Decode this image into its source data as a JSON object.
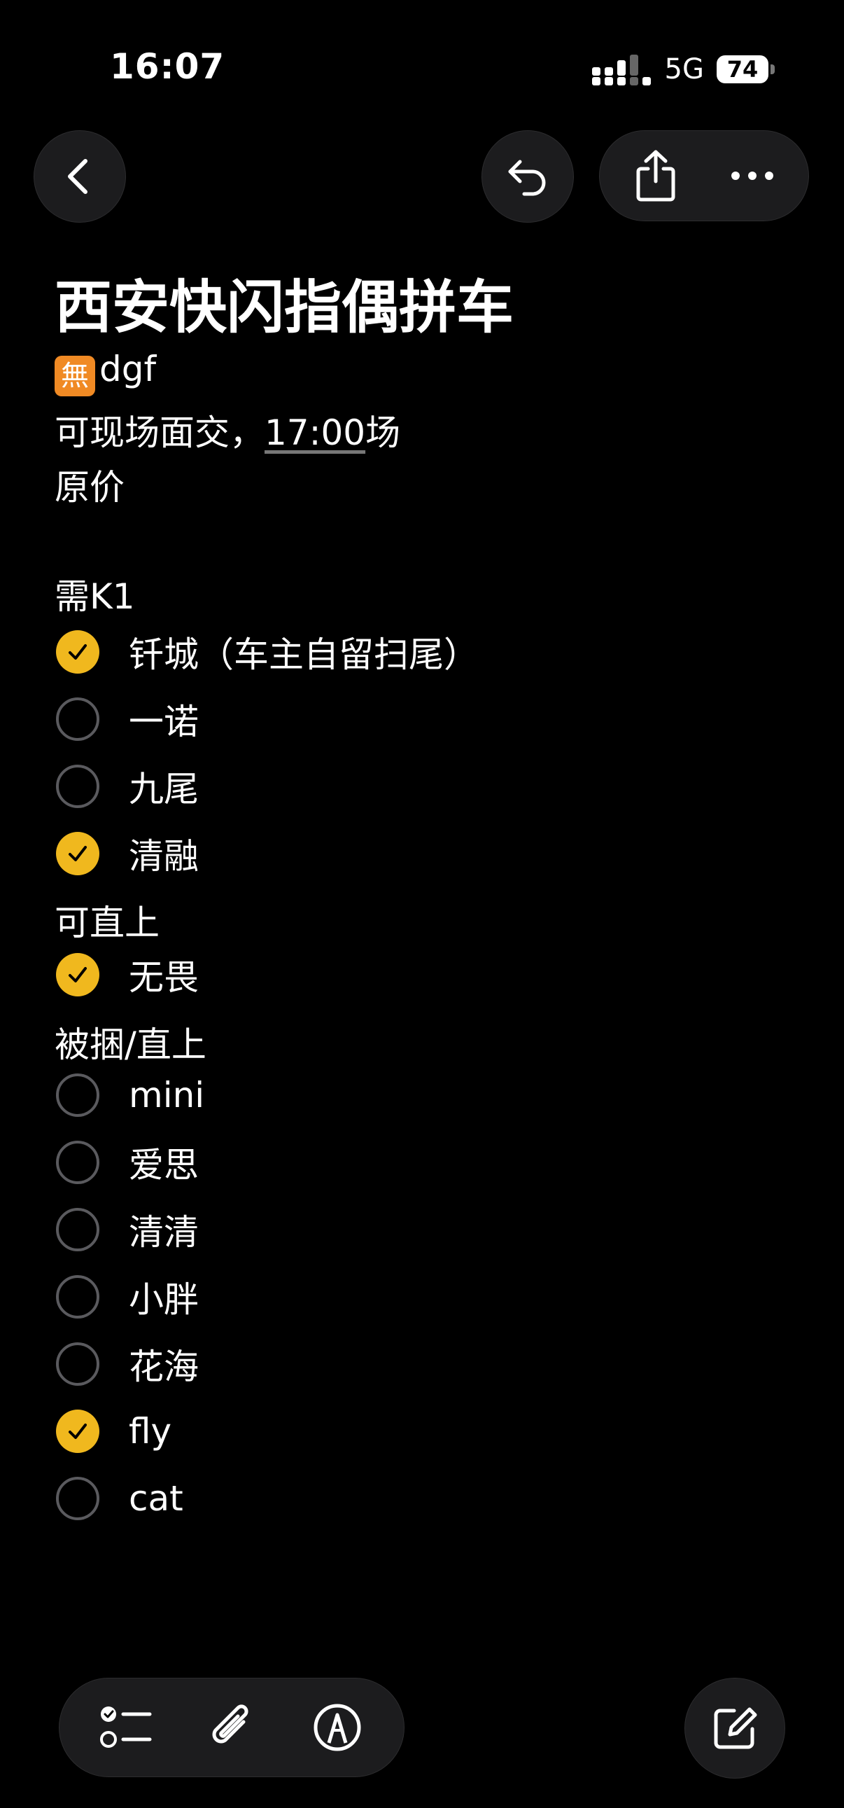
{
  "status_bar": {
    "time": "16:07",
    "network": "5G",
    "battery": "74"
  },
  "note": {
    "title": "西安快闪指偶拼车",
    "tag_glyph": "🈚",
    "tag_text": "dgf",
    "line2_prefix": "可现场面交，",
    "line2_time": "17:00",
    "line2_suffix": "场",
    "line3": "原价",
    "section1": "需K1",
    "section2": "可直上",
    "section3": "被捆/直上",
    "items1": [
      {
        "label": "钎城（车主自留扫尾）",
        "checked": true
      },
      {
        "label": "一诺",
        "checked": false
      },
      {
        "label": "九尾",
        "checked": false
      },
      {
        "label": "清融",
        "checked": true
      }
    ],
    "items2": [
      {
        "label": "无畏",
        "checked": true
      }
    ],
    "items3": [
      {
        "label": "mini",
        "checked": false
      },
      {
        "label": "爱思",
        "checked": false
      },
      {
        "label": "清清",
        "checked": false
      },
      {
        "label": "小胖",
        "checked": false
      },
      {
        "label": "花海",
        "checked": false
      },
      {
        "label": "fly",
        "checked": true
      },
      {
        "label": "cat",
        "checked": false
      }
    ]
  },
  "colors": {
    "accent": "#f0b81e",
    "background": "#000000",
    "button": "#1c1c1e"
  },
  "icons": [
    "chevron-left-icon",
    "undo-icon",
    "share-icon",
    "more-icon",
    "checklist-icon",
    "paperclip-icon",
    "markup-pen-icon",
    "compose-icon"
  ]
}
